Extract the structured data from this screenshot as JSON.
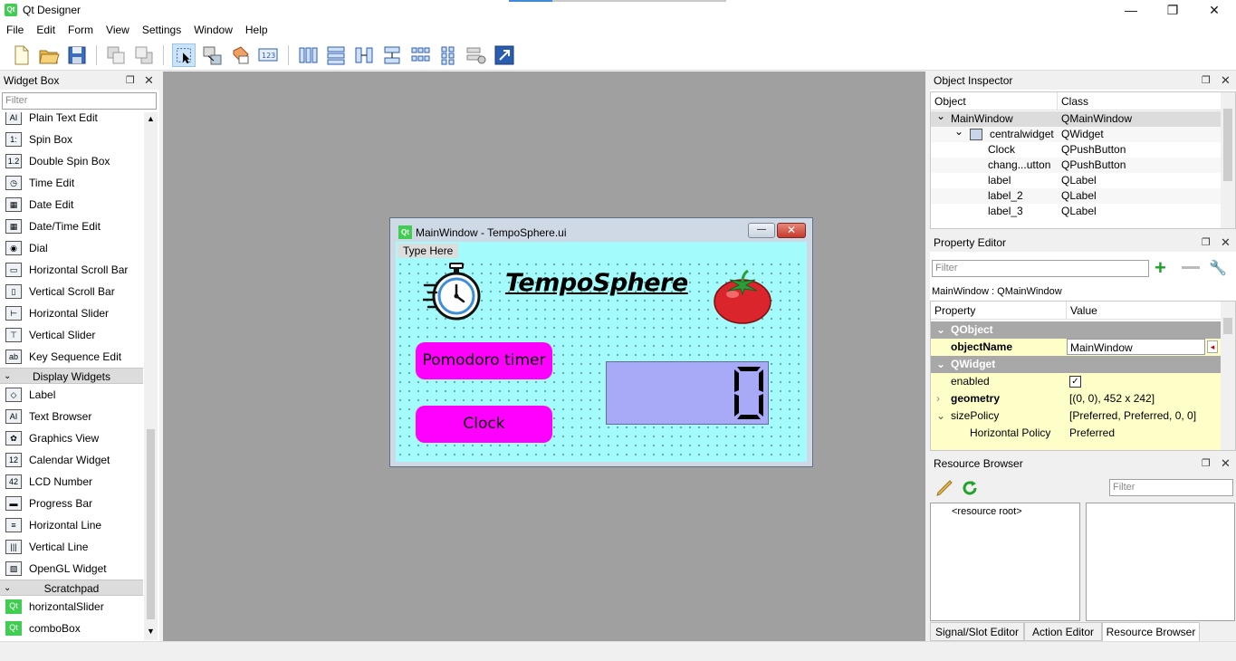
{
  "window": {
    "title": "Qt Designer",
    "logo_text": "Qt"
  },
  "menubar": {
    "items": [
      "File",
      "Edit",
      "Form",
      "View",
      "Settings",
      "Window",
      "Help"
    ]
  },
  "widget_box": {
    "title": "Widget Box",
    "filter_placeholder": "Filter",
    "items_top": [
      {
        "label": "Plain Text Edit",
        "icon": "AI"
      },
      {
        "label": "Spin Box",
        "icon": "1:"
      },
      {
        "label": "Double Spin Box",
        "icon": "1.2"
      },
      {
        "label": "Time Edit",
        "icon": "◷"
      },
      {
        "label": "Date Edit",
        "icon": "▦"
      },
      {
        "label": "Date/Time Edit",
        "icon": "▦"
      },
      {
        "label": "Dial",
        "icon": "◉"
      },
      {
        "label": "Horizontal Scroll Bar",
        "icon": "▭"
      },
      {
        "label": "Vertical Scroll Bar",
        "icon": "▯"
      },
      {
        "label": "Horizontal Slider",
        "icon": "⊢"
      },
      {
        "label": "Vertical Slider",
        "icon": "⊤"
      },
      {
        "label": "Key Sequence Edit",
        "icon": "ab"
      }
    ],
    "category_display": "Display Widgets",
    "items_display": [
      {
        "label": "Label",
        "icon": "◇"
      },
      {
        "label": "Text Browser",
        "icon": "AI"
      },
      {
        "label": "Graphics View",
        "icon": "✿"
      },
      {
        "label": "Calendar Widget",
        "icon": "12"
      },
      {
        "label": "LCD Number",
        "icon": "42"
      },
      {
        "label": "Progress Bar",
        "icon": "▬"
      },
      {
        "label": "Horizontal Line",
        "icon": "≡"
      },
      {
        "label": "Vertical Line",
        "icon": "|||"
      },
      {
        "label": "OpenGL Widget",
        "icon": "▨"
      }
    ],
    "category_scratchpad": "Scratchpad",
    "items_scratchpad": [
      {
        "label": "horizontalSlider",
        "icon": "Qt"
      },
      {
        "label": "comboBox",
        "icon": "Qt"
      }
    ]
  },
  "form": {
    "window_title": "MainWindow - TempoSphere.ui",
    "menu_placeholder": "Type Here",
    "app_title": "TempoSphere",
    "pomodoro_button": "Pomodoro timer",
    "clock_button": "Clock",
    "lcd_value": "0",
    "bg_color": "#a4fbfb",
    "button_color": "#ff00ff",
    "lcd_color": "#a9aaf7"
  },
  "object_inspector": {
    "title": "Object Inspector",
    "col_object": "Object",
    "col_class": "Class",
    "rows": [
      {
        "object": "MainWindow",
        "class": "QMainWindow"
      },
      {
        "object": "centralwidget",
        "class": "QWidget"
      },
      {
        "object": "Clock",
        "class": "QPushButton"
      },
      {
        "object": "chang...utton",
        "class": "QPushButton"
      },
      {
        "object": "label",
        "class": "QLabel"
      },
      {
        "object": "label_2",
        "class": "QLabel"
      },
      {
        "object": "label_3",
        "class": "QLabel"
      }
    ]
  },
  "property_editor": {
    "title": "Property Editor",
    "filter_placeholder": "Filter",
    "context": "MainWindow : QMainWindow",
    "col_property": "Property",
    "col_value": "Value",
    "group_qobject": "QObject",
    "group_qwidget": "QWidget",
    "rows": [
      {
        "property": "objectName",
        "value": "MainWindow"
      },
      {
        "property": "enabled",
        "value": "✓"
      },
      {
        "property": "geometry",
        "value": "[(0, 0), 452 x 242]"
      },
      {
        "property": "sizePolicy",
        "value": "[Preferred, Preferred, 0, 0]"
      },
      {
        "property": "Horizontal Policy",
        "value": "Preferred"
      }
    ]
  },
  "resource_browser": {
    "title": "Resource Browser",
    "filter_placeholder": "Filter",
    "root": "<resource root>"
  },
  "bottom_tabs": [
    "Signal/Slot Editor",
    "Action Editor",
    "Resource Browser"
  ]
}
